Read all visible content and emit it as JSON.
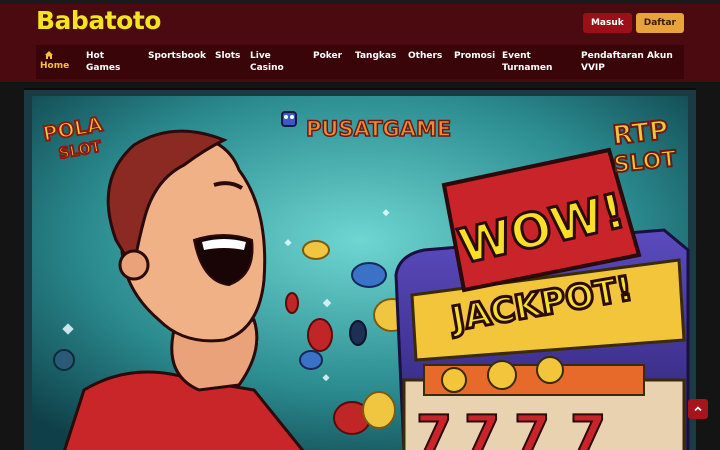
{
  "header": {
    "logo": "Babatoto",
    "login_label": "Masuk",
    "register_label": "Daftar"
  },
  "nav": {
    "items": [
      {
        "label": "Home",
        "active": true
      },
      {
        "label": "Hot Games"
      },
      {
        "label": "Sportsbook"
      },
      {
        "label": "Slots"
      },
      {
        "label": "Live Casino"
      },
      {
        "label": "Poker"
      },
      {
        "label": "Tangkas"
      },
      {
        "label": "Others"
      },
      {
        "label": "Promosi"
      },
      {
        "label": "Event Turnamen"
      },
      {
        "label": "Pendaftaran Akun VVIP"
      }
    ]
  },
  "banner": {
    "badge_left": [
      "POLA",
      "SLOT"
    ],
    "brand": "PUSATGAME",
    "wow": "WOW!",
    "rtp": [
      "RTP",
      "SLOT"
    ],
    "jackpot": "JACKPOT!",
    "reels": [
      "7",
      "7",
      "7",
      "7"
    ]
  },
  "colors": {
    "header_bg": "#4b0a10",
    "logo": "#f3e420",
    "accent": "#e8a43a",
    "active_nav": "#f3c13a"
  }
}
